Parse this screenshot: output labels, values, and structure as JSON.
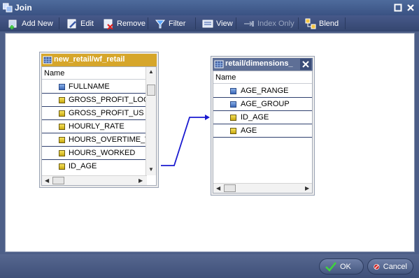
{
  "window": {
    "title": "Join"
  },
  "toolbar": {
    "add_new": "Add New",
    "edit": "Edit",
    "remove": "Remove",
    "filter": "Filter",
    "view": "View",
    "index_only": "Index Only",
    "blend": "Blend"
  },
  "left_table": {
    "title": "new_retail/wf_retail",
    "column_header": "Name",
    "fields": [
      {
        "name": "FULLNAME",
        "icon": "measure-field-icon"
      },
      {
        "name": "GROSS_PROFIT_LOCAL",
        "icon": "key-field-icon"
      },
      {
        "name": "GROSS_PROFIT_US",
        "icon": "key-field-icon"
      },
      {
        "name": "HOURLY_RATE",
        "icon": "key-field-icon"
      },
      {
        "name": "HOURS_OVERTIME_WORKED",
        "icon": "key-field-icon"
      },
      {
        "name": "HOURS_WORKED",
        "icon": "key-field-icon"
      },
      {
        "name": "ID_AGE",
        "icon": "key-field-icon"
      }
    ]
  },
  "right_table": {
    "title": "retail/dimensions_",
    "column_header": "Name",
    "fields": [
      {
        "name": "AGE_RANGE",
        "icon": "measure-field-icon"
      },
      {
        "name": "AGE_GROUP",
        "icon": "measure-field-icon"
      },
      {
        "name": "ID_AGE",
        "icon": "key-field-icon"
      },
      {
        "name": "AGE",
        "icon": "key-field-icon"
      }
    ]
  },
  "footer": {
    "ok": "OK",
    "cancel": "Cancel"
  },
  "colors": {
    "join_line": "#1a1ad0",
    "left_header": "#d6a62b",
    "right_header": "#5e6f96"
  }
}
